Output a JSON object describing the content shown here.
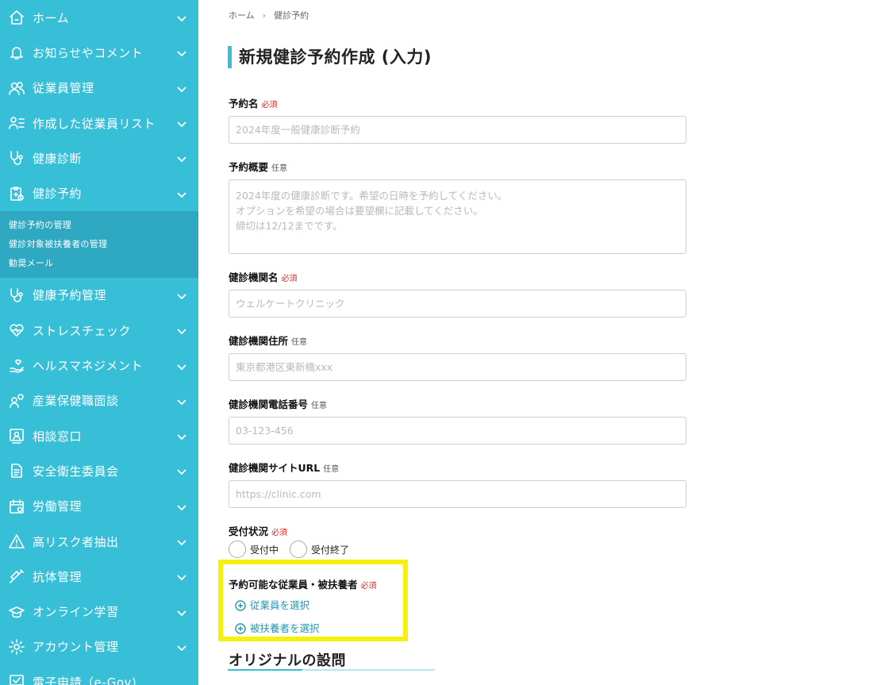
{
  "sidebar": {
    "items": [
      {
        "label": "ホーム",
        "icon": "home-icon"
      },
      {
        "label": "お知らせやコメント",
        "icon": "bell-icon"
      },
      {
        "label": "従業員管理",
        "icon": "users-icon"
      },
      {
        "label": "作成した従業員リスト",
        "icon": "user-list-icon"
      },
      {
        "label": "健康診断",
        "icon": "stethoscope-icon"
      },
      {
        "label": "健診予約",
        "icon": "clipboard-icon"
      },
      {
        "label": "健康予約管理",
        "icon": "stethoscope-icon"
      },
      {
        "label": "ストレスチェック",
        "icon": "heart-icon"
      },
      {
        "label": "ヘルスマネジメント",
        "icon": "hand-heart-icon"
      },
      {
        "label": "産業保健職面談",
        "icon": "user-chat-icon"
      },
      {
        "label": "相談窓口",
        "icon": "user-box-icon"
      },
      {
        "label": "安全衛生委員会",
        "icon": "document-icon"
      },
      {
        "label": "労働管理",
        "icon": "calendar-icon"
      },
      {
        "label": "高リスク者抽出",
        "icon": "alert-icon"
      },
      {
        "label": "抗体管理",
        "icon": "syringe-icon"
      },
      {
        "label": "オンライン学習",
        "icon": "graduation-cap-icon"
      },
      {
        "label": "アカウント管理",
        "icon": "gear-icon"
      },
      {
        "label": "電子申請（e-Gov)",
        "icon": "monitor-check-icon"
      }
    ],
    "submenu": [
      {
        "label": "健診予約の管理"
      },
      {
        "label": "健診対象被扶養者の管理"
      },
      {
        "label": "勧奨メール"
      }
    ]
  },
  "breadcrumb": {
    "home": "ホーム",
    "sep": "›",
    "current": "健診予約"
  },
  "page_title": "新規健診予約作成 (入力)",
  "form": {
    "name": {
      "label": "予約名",
      "tag": "必須",
      "placeholder": "2024年度一般健康診断予約"
    },
    "summary": {
      "label": "予約概要",
      "tag": "任意",
      "placeholder": "2024年度の健康診断です。希望の日時を予約してください。\nオプションを希望の場合は要望欄に記載してください。\n締切は12/12までです。"
    },
    "clinic_name": {
      "label": "健診機関名",
      "tag": "必須",
      "placeholder": "ウェルケートクリニック"
    },
    "clinic_address": {
      "label": "健診機関住所",
      "tag": "任意",
      "placeholder": "東京都港区東新橋xxx"
    },
    "clinic_phone": {
      "label": "健診機関電話番号",
      "tag": "任意",
      "placeholder": "03-123-456"
    },
    "clinic_url": {
      "label": "健診機関サイトURL",
      "tag": "任意",
      "placeholder": "https://clinic.com"
    },
    "status": {
      "label": "受付状況",
      "tag": "必須",
      "options": [
        "受付中",
        "受付終了"
      ]
    },
    "targets": {
      "label": "予約可能な従業員・被扶養者",
      "tag": "必須",
      "select_employees": "従業員を選択",
      "select_dependents": "被扶養者を選択"
    }
  },
  "section": {
    "title": "オリジナルの設問"
  },
  "colors": {
    "sidebar": "#38bfd8",
    "accent": "#38bfd8",
    "required": "#e0231c",
    "link": "#2596b0",
    "highlight": "#f6f00f"
  }
}
